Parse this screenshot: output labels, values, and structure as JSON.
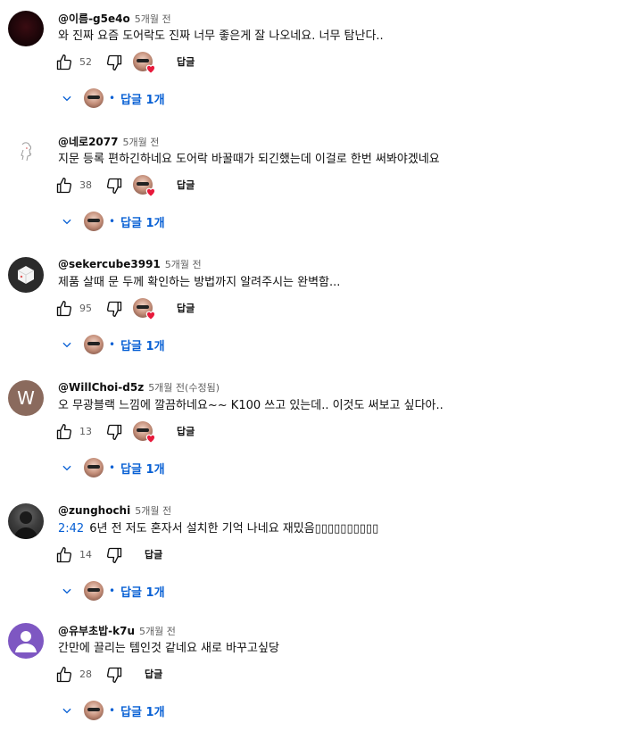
{
  "colors": {
    "link": "#065fd4",
    "text": "#0f0f0f",
    "muted": "#606060",
    "heart": "#e8193b"
  },
  "comments": [
    {
      "author": "@이름-g5e4o",
      "time": "5개월 전",
      "text": "와 진짜 요즘 도어락도 진짜 너무 좋은게 잘 나오네요. 너무 탐난다..",
      "likes": "52",
      "reply_label": "답글",
      "replies_label": "답글 1개",
      "hearted": true,
      "avatar_icon": "dark-avatar"
    },
    {
      "author": "@네로2077",
      "time": "5개월 전",
      "text": "지문 등록 편하긴하네요 도어락 바꿀때가 되긴했는데 이걸로 한번 써봐야겠네요",
      "likes": "38",
      "reply_label": "답글",
      "replies_label": "답글 1개",
      "hearted": true,
      "avatar_icon": "sketch-avatar"
    },
    {
      "author": "@sekercube3991",
      "time": "5개월 전",
      "text": "제품 살때 문 두께 확인하는 방법까지 알려주시는 완벽함...",
      "likes": "95",
      "reply_label": "답글",
      "replies_label": "답글 1개",
      "hearted": true,
      "avatar_icon": "cube-avatar"
    },
    {
      "author": "@WillChoi-d5z",
      "time": "5개월 전(수정됨)",
      "text": "오 무광블랙 느낌에 깔끔하네요~~ K100 쓰고 있는데.. 이것도 써보고 싶다아..",
      "likes": "13",
      "reply_label": "답글",
      "replies_label": "답글 1개",
      "hearted": true,
      "avatar_letter": "W"
    },
    {
      "author": "@zunghochi",
      "time": "5개월 전",
      "timestamp": "2:42",
      "text": "6년 전 저도 혼자서 설치한 기억 나네요 재밌음▯▯▯▯▯▯▯▯▯▯",
      "likes": "14",
      "reply_label": "답글",
      "replies_label": "답글 1개",
      "hearted": false,
      "avatar_icon": "photo-avatar"
    },
    {
      "author": "@유부초밥-k7u",
      "time": "5개월 전",
      "text": "간만에 끌리는 템인것 같네요 새로 바꾸고싶당",
      "likes": "28",
      "reply_label": "답글",
      "replies_label": "답글 1개",
      "hearted": false,
      "avatar_icon": "default-person-avatar"
    }
  ]
}
